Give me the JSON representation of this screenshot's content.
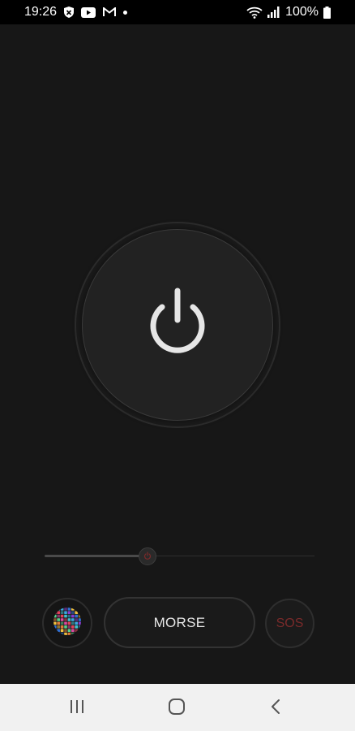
{
  "status_bar": {
    "time": "19:26",
    "battery": "100%",
    "left_icons": [
      "shield-icon",
      "youtube-icon",
      "gmail-icon",
      "dot-icon"
    ],
    "right_icons": [
      "wifi-icon",
      "signal-icon",
      "battery-icon"
    ]
  },
  "main": {
    "power_icon": "power-icon",
    "brightness_level": 0.38,
    "slider_thumb_icon": "power-icon",
    "disco_icon": "disco-ball-icon",
    "morse_label": "MORSE",
    "sos_label": "SOS"
  },
  "nav": {
    "recents_icon": "recents-icon",
    "home_icon": "home-icon",
    "back_icon": "back-icon"
  },
  "colors": {
    "background": "#171717",
    "status_bar": "#000000",
    "nav_bar": "#f1f1f1",
    "sos_text": "#7a2a2a",
    "power_icon": "#e6e6e6"
  }
}
